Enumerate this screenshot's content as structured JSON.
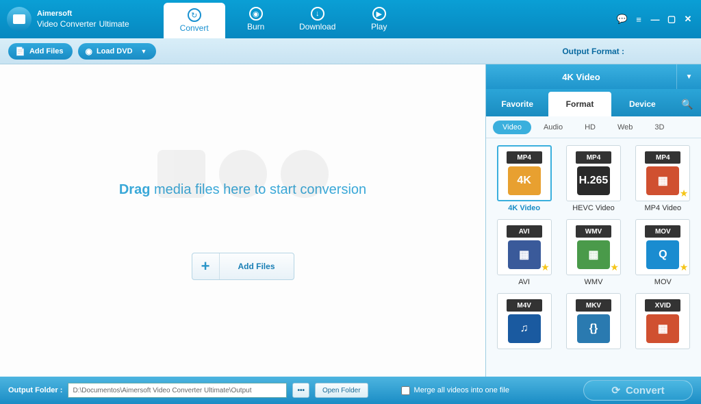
{
  "brand": "Aimersoft",
  "product": "Video Converter",
  "edition": "Ultimate",
  "main_tabs": [
    {
      "label": "Convert",
      "icon": "↻",
      "active": true
    },
    {
      "label": "Burn",
      "icon": "◉",
      "active": false
    },
    {
      "label": "Download",
      "icon": "↓",
      "active": false
    },
    {
      "label": "Play",
      "icon": "▶",
      "active": false
    }
  ],
  "toolbar": {
    "add_files": "Add Files",
    "load_dvd": "Load DVD",
    "output_format_label": "Output Format :"
  },
  "drop": {
    "drag": "Drag",
    "rest": " media files here to start conversion",
    "add_files_btn": "Add Files"
  },
  "format": {
    "selected": "4K Video",
    "tabs": [
      {
        "label": "Favorite",
        "active": false
      },
      {
        "label": "Format",
        "active": true
      },
      {
        "label": "Device",
        "active": false
      }
    ],
    "sub_tabs": [
      {
        "label": "Video",
        "active": true
      },
      {
        "label": "Audio",
        "active": false
      },
      {
        "label": "HD",
        "active": false
      },
      {
        "label": "Web",
        "active": false
      },
      {
        "label": "3D",
        "active": false
      }
    ],
    "items": [
      {
        "badge": "MP4",
        "icon": "4K",
        "icon_bg": "#e8a030",
        "name": "4K Video",
        "selected": true,
        "star": false
      },
      {
        "badge": "MP4",
        "icon": "H.265",
        "icon_bg": "#2a2a2a",
        "name": "HEVC Video",
        "selected": false,
        "star": false
      },
      {
        "badge": "MP4",
        "icon": "▦",
        "icon_bg": "#d05030",
        "name": "MP4 Video",
        "selected": false,
        "star": true
      },
      {
        "badge": "AVI",
        "icon": "▦",
        "icon_bg": "#3a5a9a",
        "name": "AVI",
        "selected": false,
        "star": true
      },
      {
        "badge": "WMV",
        "icon": "▦",
        "icon_bg": "#4a9a4a",
        "name": "WMV",
        "selected": false,
        "star": true
      },
      {
        "badge": "MOV",
        "icon": "Q",
        "icon_bg": "#1a8cd0",
        "name": "MOV",
        "selected": false,
        "star": true
      },
      {
        "badge": "M4V",
        "icon": "♫",
        "icon_bg": "#1a5aa0",
        "name": "",
        "selected": false,
        "star": false
      },
      {
        "badge": "MKV",
        "icon": "{}",
        "icon_bg": "#2a7ab0",
        "name": "",
        "selected": false,
        "star": false
      },
      {
        "badge": "XVID",
        "icon": "▦",
        "icon_bg": "#d05030",
        "name": "",
        "selected": false,
        "star": false
      }
    ]
  },
  "footer": {
    "label": "Output Folder :",
    "path": "D:\\Documentos\\Aimersoft Video Converter Ultimate\\Output",
    "open_folder": "Open Folder",
    "merge": "Merge all videos into one file",
    "convert": "Convert"
  }
}
